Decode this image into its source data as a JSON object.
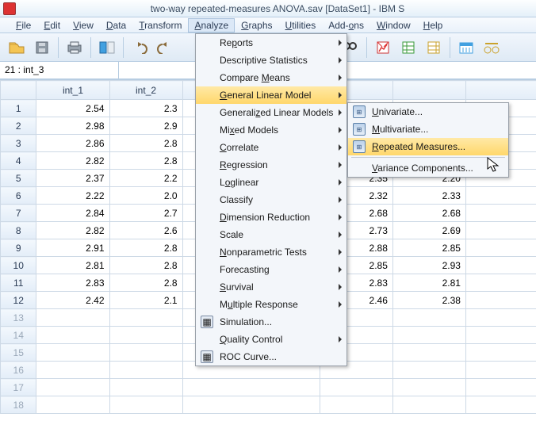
{
  "titlebar": {
    "title": "two-way repeated-measures ANOVA.sav [DataSet1] - IBM S"
  },
  "menubar": {
    "items": [
      {
        "label": "File",
        "u": "F"
      },
      {
        "label": "Edit",
        "u": "E"
      },
      {
        "label": "View",
        "u": "V"
      },
      {
        "label": "Data",
        "u": "D"
      },
      {
        "label": "Transform",
        "u": "T"
      },
      {
        "label": "Analyze",
        "u": "A",
        "open": true
      },
      {
        "label": "Graphs",
        "u": "G"
      },
      {
        "label": "Utilities",
        "u": "U"
      },
      {
        "label": "Add-ons",
        "u": "o"
      },
      {
        "label": "Window",
        "u": "W"
      },
      {
        "label": "Help",
        "u": "H"
      }
    ]
  },
  "cellref": {
    "label": "21 : int_3",
    "value": ""
  },
  "columns": [
    "int_1",
    "int_2"
  ],
  "rows": [
    {
      "n": "1",
      "v": [
        "2.54",
        "2.3"
      ],
      "c": [
        "",
        ""
      ]
    },
    {
      "n": "2",
      "v": [
        "2.98",
        "2.9"
      ],
      "c": [
        "",
        ""
      ]
    },
    {
      "n": "3",
      "v": [
        "2.86",
        "2.8"
      ],
      "c": [
        "",
        ""
      ]
    },
    {
      "n": "4",
      "v": [
        "2.82",
        "2.8"
      ],
      "c": [
        "",
        ""
      ]
    },
    {
      "n": "5",
      "v": [
        "2.37",
        "2.2"
      ],
      "c": [
        "2.35",
        "2.20"
      ]
    },
    {
      "n": "6",
      "v": [
        "2.22",
        "2.0"
      ],
      "c": [
        "2.32",
        "2.33"
      ]
    },
    {
      "n": "7",
      "v": [
        "2.84",
        "2.7"
      ],
      "c": [
        "2.68",
        "2.68"
      ]
    },
    {
      "n": "8",
      "v": [
        "2.82",
        "2.6"
      ],
      "c": [
        "2.73",
        "2.69"
      ]
    },
    {
      "n": "9",
      "v": [
        "2.91",
        "2.8"
      ],
      "c": [
        "2.88",
        "2.85"
      ]
    },
    {
      "n": "10",
      "v": [
        "2.81",
        "2.8"
      ],
      "c": [
        "2.85",
        "2.93"
      ]
    },
    {
      "n": "11",
      "v": [
        "2.83",
        "2.8"
      ],
      "c": [
        "2.83",
        "2.81"
      ]
    },
    {
      "n": "12",
      "v": [
        "2.42",
        "2.1"
      ],
      "c": [
        "2.46",
        "2.38"
      ]
    }
  ],
  "empty_rows": [
    "13",
    "14",
    "15",
    "16",
    "17",
    "18"
  ],
  "analyze_menu": [
    {
      "label": "Reports",
      "u": "p",
      "sub": true
    },
    {
      "label": "Descriptive Statistics",
      "u": "E",
      "sub": true
    },
    {
      "label": "Compare Means",
      "u": "M",
      "sub": true
    },
    {
      "label": "General Linear Model",
      "u": "G",
      "sub": true,
      "hl": true
    },
    {
      "label": "Generalized Linear Models",
      "u": "z",
      "sub": true
    },
    {
      "label": "Mixed Models",
      "u": "x",
      "sub": true
    },
    {
      "label": "Correlate",
      "u": "C",
      "sub": true
    },
    {
      "label": "Regression",
      "u": "R",
      "sub": true
    },
    {
      "label": "Loglinear",
      "u": "o",
      "sub": true
    },
    {
      "label": "Classify",
      "u": "F",
      "sub": true
    },
    {
      "label": "Dimension Reduction",
      "u": "D",
      "sub": true
    },
    {
      "label": "Scale",
      "u": "A",
      "sub": true
    },
    {
      "label": "Nonparametric Tests",
      "u": "N",
      "sub": true
    },
    {
      "label": "Forecasting",
      "u": "T",
      "sub": true
    },
    {
      "label": "Survival",
      "u": "S",
      "sub": true
    },
    {
      "label": "Multiple Response",
      "u": "u",
      "sub": true
    },
    {
      "label": "Simulation...",
      "u": "",
      "sub": false,
      "icon": true
    },
    {
      "label": "Quality Control",
      "u": "Q",
      "sub": true
    },
    {
      "label": "ROC Curve...",
      "u": "V",
      "sub": false,
      "icon": true
    }
  ],
  "glm_submenu": [
    {
      "label": "Univariate...",
      "u": "U",
      "icon": true
    },
    {
      "label": "Multivariate...",
      "u": "M",
      "icon": true
    },
    {
      "label": "Repeated Measures...",
      "u": "R",
      "icon": true,
      "hl": true
    },
    {
      "sep": true
    },
    {
      "label": "Variance Components...",
      "u": "V",
      "icon": false
    }
  ],
  "toolbar_icons": [
    "open",
    "save",
    "print",
    "",
    "preview",
    "",
    "undo",
    "redo",
    "",
    "",
    "find",
    "",
    "chart",
    "table-green",
    "table-yellow",
    "",
    "date",
    "weight"
  ]
}
